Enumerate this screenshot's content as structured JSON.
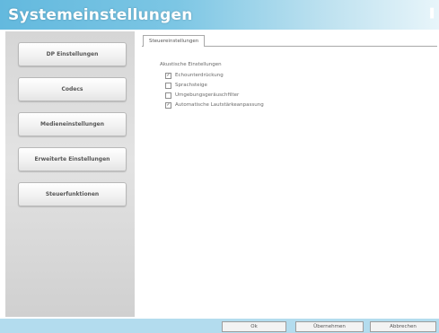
{
  "window": {
    "title": "Systemeinstellungen"
  },
  "sidebar": {
    "items": [
      {
        "label": "DP Einstellungen"
      },
      {
        "label": "Codecs"
      },
      {
        "label": "Medieneinstellungen"
      },
      {
        "label": "Erweiterte Einstellungen"
      },
      {
        "label": "Steuerfunktionen"
      }
    ]
  },
  "tabs": [
    {
      "label": "Steuereinstellungen",
      "active": true
    }
  ],
  "panel": {
    "group_heading": "Akustische Einstellungen",
    "options": [
      {
        "label": "Echounterdrückung",
        "checked": true
      },
      {
        "label": "Sprachsteige",
        "checked": false
      },
      {
        "label": "Umgebungsgeräuschfilter",
        "checked": false
      },
      {
        "label": "Automatische Lautstärkeanpassung",
        "checked": true
      }
    ]
  },
  "footer": {
    "ok_label": "Ok",
    "apply_label": "Übernehmen",
    "cancel_label": "Abbrechen"
  }
}
